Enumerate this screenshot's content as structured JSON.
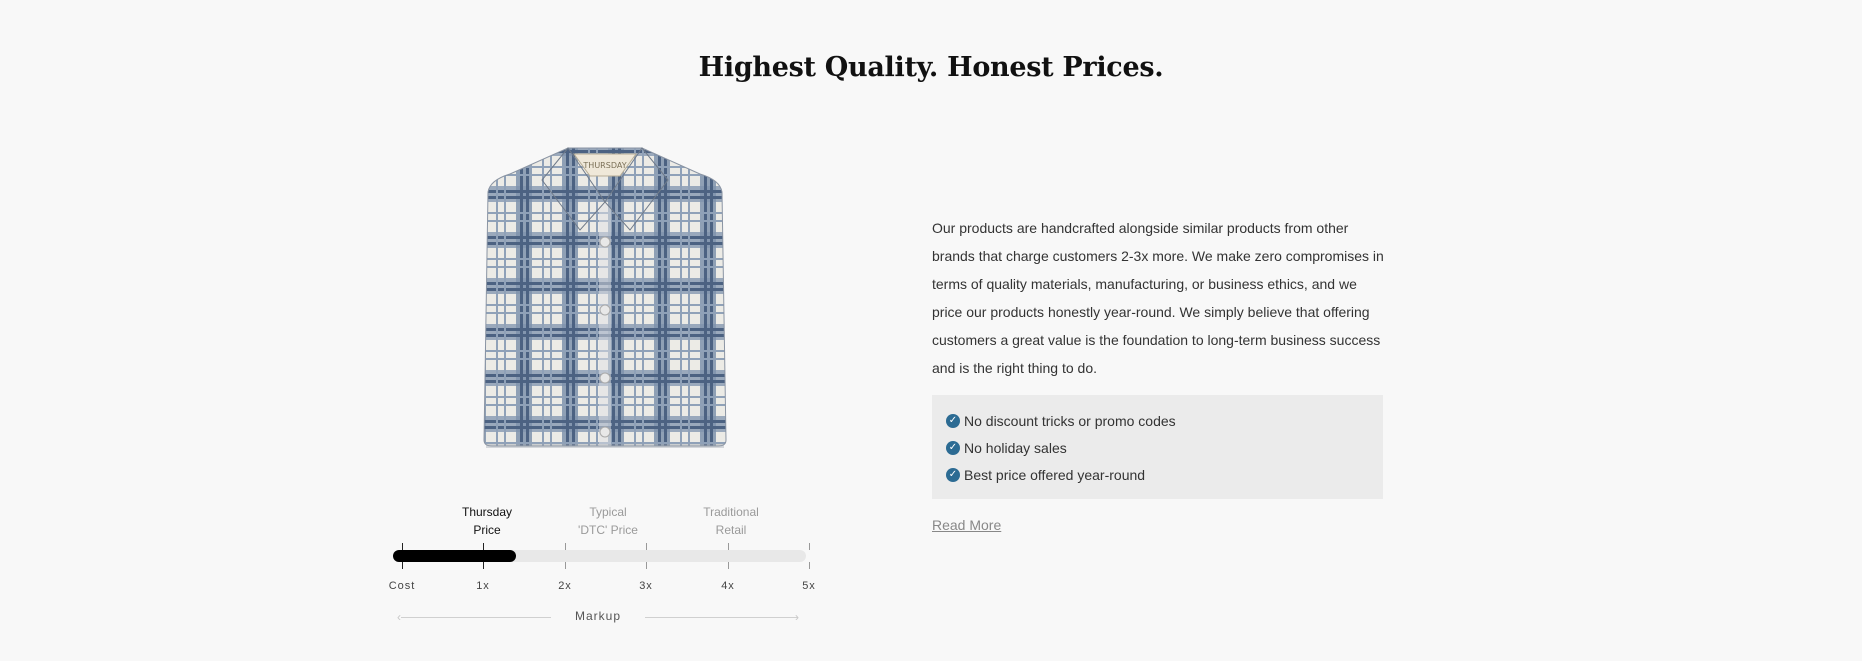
{
  "section": {
    "title": "Highest Quality. Honest Prices."
  },
  "product_image": {
    "alt": "Blue and white plaid flannel shirt",
    "label_text": "THURSDAY"
  },
  "markup_chart": {
    "columns": [
      {
        "label_line1": "Thursday",
        "label_line2": "Price",
        "state": "active"
      },
      {
        "label_line1": "Typical",
        "label_line2": "'DTC' Price",
        "state": "muted"
      },
      {
        "label_line1": "Traditional",
        "label_line2": "Retail",
        "state": "muted"
      }
    ],
    "ticks": [
      "Cost",
      "1x",
      "2x",
      "3x",
      "4x",
      "5x"
    ],
    "axis_label": "Markup",
    "thursday_markup_value": 1.4
  },
  "description": "Our products are handcrafted alongside similar products from other brands that charge customers 2-3x more. We make zero compromises in terms of quality materials, manufacturing, or business ethics, and we price our products honestly year-round. We simply believe that offering customers a great value is the foundation to long-term business success and is the right thing to do.",
  "benefits": [
    {
      "icon": "check-circle-icon",
      "text": "No discount tricks or promo codes"
    },
    {
      "icon": "check-circle-icon",
      "text": "No holiday sales"
    },
    {
      "icon": "check-circle-icon",
      "text": "Best price offered year-round"
    }
  ],
  "read_more": "Read More",
  "colors": {
    "accent_check": "#2c6b93",
    "bar_fill": "#000000",
    "bar_track": "#e8e8e8",
    "benefits_bg": "#ebebeb"
  }
}
